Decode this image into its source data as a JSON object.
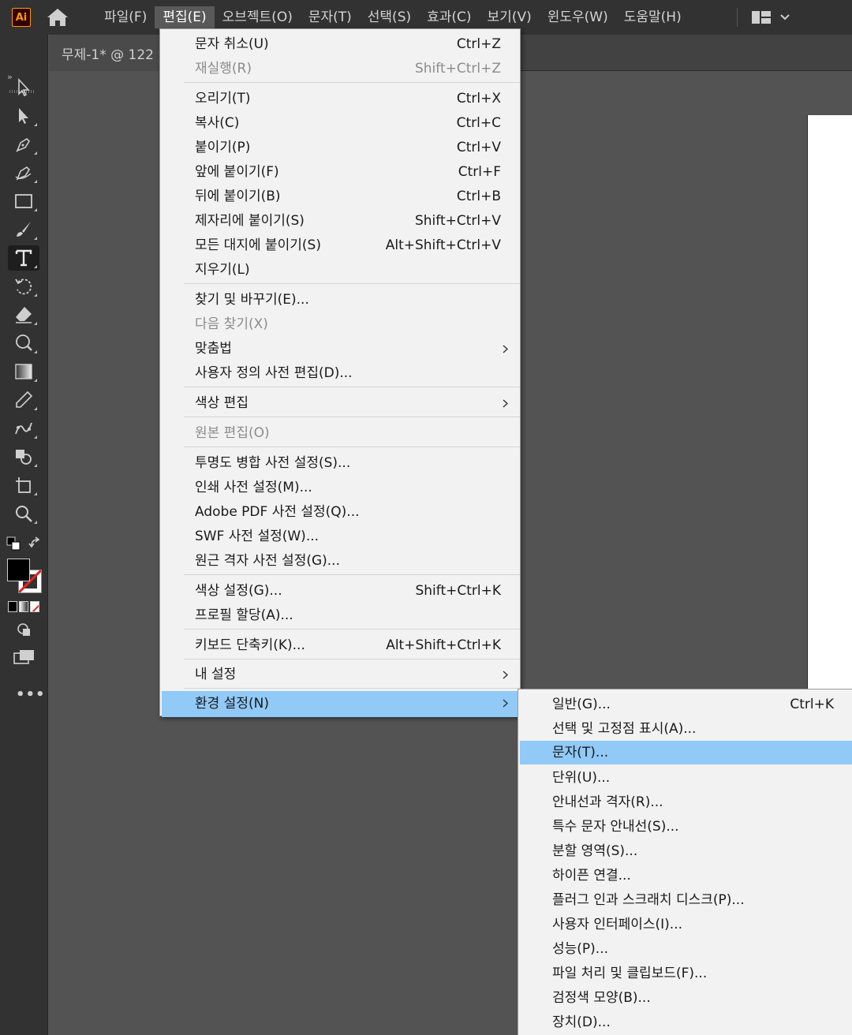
{
  "app": {
    "logo_text": "Ai"
  },
  "menubar": {
    "items": [
      {
        "label": "파일(F)"
      },
      {
        "label": "편집(E)"
      },
      {
        "label": "오브젝트(O)"
      },
      {
        "label": "문자(T)"
      },
      {
        "label": "선택(S)"
      },
      {
        "label": "효과(C)"
      },
      {
        "label": "보기(V)"
      },
      {
        "label": "윈도우(W)"
      },
      {
        "label": "도움말(H)"
      }
    ]
  },
  "document": {
    "tab_title": "무제-1* @ 122"
  },
  "edit_menu": {
    "items": [
      {
        "label": "문자 취소(U)",
        "shortcut": "Ctrl+Z"
      },
      {
        "label": "재실행(R)",
        "shortcut": "Shift+Ctrl+Z"
      },
      {
        "label": "오리기(T)",
        "shortcut": "Ctrl+X"
      },
      {
        "label": "복사(C)",
        "shortcut": "Ctrl+C"
      },
      {
        "label": "붙이기(P)",
        "shortcut": "Ctrl+V"
      },
      {
        "label": "앞에 붙이기(F)",
        "shortcut": "Ctrl+F"
      },
      {
        "label": "뒤에 붙이기(B)",
        "shortcut": "Ctrl+B"
      },
      {
        "label": "제자리에 붙이기(S)",
        "shortcut": "Shift+Ctrl+V"
      },
      {
        "label": "모든 대지에 붙이기(S)",
        "shortcut": "Alt+Shift+Ctrl+V"
      },
      {
        "label": "지우기(L)",
        "shortcut": ""
      },
      {
        "label": "찾기 및 바꾸기(E)...",
        "shortcut": ""
      },
      {
        "label": "다음 찾기(X)",
        "shortcut": ""
      },
      {
        "label": "맞춤법",
        "shortcut": ""
      },
      {
        "label": "사용자 정의 사전 편집(D)...",
        "shortcut": ""
      },
      {
        "label": "색상 편집",
        "shortcut": ""
      },
      {
        "label": "원본 편집(O)",
        "shortcut": ""
      },
      {
        "label": "투명도 병합 사전 설정(S)...",
        "shortcut": ""
      },
      {
        "label": "인쇄 사전 설정(M)...",
        "shortcut": ""
      },
      {
        "label": "Adobe PDF 사전 설정(Q)...",
        "shortcut": ""
      },
      {
        "label": "SWF 사전 설정(W)...",
        "shortcut": ""
      },
      {
        "label": "원근 격자 사전 설정(G)...",
        "shortcut": ""
      },
      {
        "label": "색상 설정(G)...",
        "shortcut": "Shift+Ctrl+K"
      },
      {
        "label": "프로필 할당(A)...",
        "shortcut": ""
      },
      {
        "label": "키보드 단축키(K)...",
        "shortcut": "Alt+Shift+Ctrl+K"
      },
      {
        "label": "내 설정",
        "shortcut": ""
      },
      {
        "label": "환경 설정(N)",
        "shortcut": ""
      }
    ]
  },
  "preferences_submenu": {
    "items": [
      {
        "label": "일반(G)...",
        "shortcut": "Ctrl+K"
      },
      {
        "label": "선택 및 고정점 표시(A)...",
        "shortcut": ""
      },
      {
        "label": "문자(T)...",
        "shortcut": ""
      },
      {
        "label": "단위(U)...",
        "shortcut": ""
      },
      {
        "label": "안내선과 격자(R)...",
        "shortcut": ""
      },
      {
        "label": "특수 문자 안내선(S)...",
        "shortcut": ""
      },
      {
        "label": "분할 영역(S)...",
        "shortcut": ""
      },
      {
        "label": "하이픈 연결...",
        "shortcut": ""
      },
      {
        "label": "플러그 인과 스크래치 디스크(P)...",
        "shortcut": ""
      },
      {
        "label": "사용자 인터페이스(I)...",
        "shortcut": ""
      },
      {
        "label": "성능(P)...",
        "shortcut": ""
      },
      {
        "label": "파일 처리 및 클립보드(F)...",
        "shortcut": ""
      },
      {
        "label": "검정색 모양(B)...",
        "shortcut": ""
      },
      {
        "label": "장치(D)...",
        "shortcut": ""
      }
    ]
  },
  "colors": {
    "highlight": "#91c9f7",
    "menu_bg": "#f2f2f2",
    "app_bg": "#535353",
    "chrome": "#323232"
  }
}
